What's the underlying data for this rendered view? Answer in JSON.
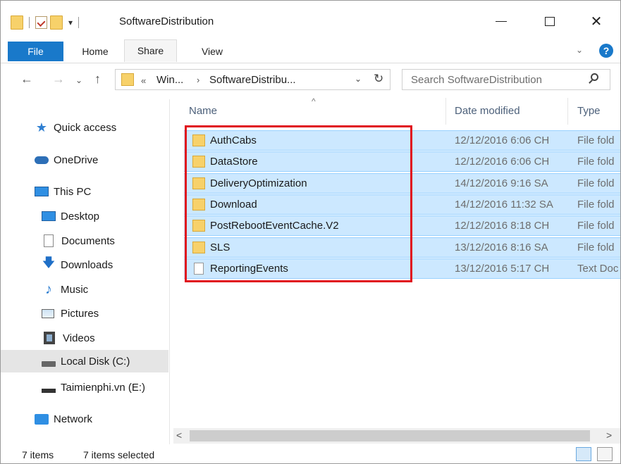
{
  "window": {
    "title": "SoftwareDistribution",
    "quick_access_dropdown": "▾"
  },
  "ribbon": {
    "tabs": [
      "File",
      "Home",
      "Share",
      "View"
    ],
    "chevron": "⌄",
    "help": "?"
  },
  "address_bar": {
    "back": "←",
    "forward": "→",
    "recent": "⌄",
    "up": "↑",
    "overflow": "«",
    "crumbs": [
      "Win...",
      "SoftwareDistribu..."
    ],
    "separator": "›",
    "dropdown": "⌄",
    "refresh": "↻"
  },
  "search": {
    "placeholder": "Search SoftwareDistribution"
  },
  "nav_pane": {
    "items": [
      {
        "label": "Quick access",
        "icon": "star-icon"
      },
      {
        "label": "OneDrive",
        "icon": "cloud-icon"
      },
      {
        "label": "This PC",
        "icon": "computer-icon"
      },
      {
        "label": "Desktop",
        "icon": "desktop-icon"
      },
      {
        "label": "Documents",
        "icon": "documents-icon"
      },
      {
        "label": "Downloads",
        "icon": "download-arrow-icon"
      },
      {
        "label": "Music",
        "icon": "music-note-icon"
      },
      {
        "label": "Pictures",
        "icon": "pictures-icon"
      },
      {
        "label": "Videos",
        "icon": "video-film-icon"
      },
      {
        "label": "Local Disk (C:)",
        "icon": "hard-drive-icon",
        "selected": true
      },
      {
        "label": "Taimienphi.vn  (E:)",
        "icon": "usb-drive-icon"
      },
      {
        "label": "Network",
        "icon": "network-icon"
      }
    ],
    "glyphs": {
      "star": "★",
      "down": "🡇",
      "music": "♪"
    }
  },
  "file_list": {
    "columns": {
      "name": "Name",
      "date": "Date modified",
      "type": "Type",
      "sort_arrow": "^"
    },
    "rows": [
      {
        "name": "AuthCabs",
        "date": "12/12/2016 6:06 CH",
        "type": "File fold",
        "icon": "folder-icon"
      },
      {
        "name": "DataStore",
        "date": "12/12/2016 6:06 CH",
        "type": "File fold",
        "icon": "folder-icon"
      },
      {
        "name": "DeliveryOptimization",
        "date": "14/12/2016 9:16 SA",
        "type": "File fold",
        "icon": "folder-icon"
      },
      {
        "name": "Download",
        "date": "14/12/2016 11:32 SA",
        "type": "File fold",
        "icon": "folder-icon"
      },
      {
        "name": "PostRebootEventCache.V2",
        "date": "12/12/2016 8:18 CH",
        "type": "File fold",
        "icon": "folder-icon"
      },
      {
        "name": "SLS",
        "date": "13/12/2016 8:16 SA",
        "type": "File fold",
        "icon": "folder-icon"
      },
      {
        "name": "ReportingEvents",
        "date": "13/12/2016 5:17 CH",
        "type": "Text Doc",
        "icon": "text-file-icon"
      }
    ]
  },
  "scrollbar": {
    "left": "<",
    "right": ">"
  },
  "status": {
    "item_count": "7 items",
    "selected": "7 items selected"
  },
  "colors": {
    "accent": "#1979ca",
    "selection": "#cce8ff",
    "highlight_box": "#e0101c",
    "folder": "#f7d16a"
  }
}
